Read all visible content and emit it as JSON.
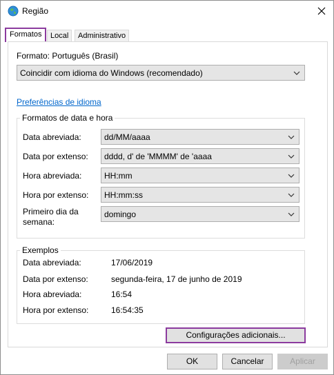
{
  "window": {
    "title": "Região"
  },
  "tabs": [
    {
      "label": "Formatos"
    },
    {
      "label": "Local"
    },
    {
      "label": "Administrativo"
    }
  ],
  "format": {
    "label": "Formato: Português (Brasil)",
    "selected": "Coincidir com idioma do Windows (recomendado)"
  },
  "language_prefs_link": "Preferências de idioma",
  "date_time_formats": {
    "title": "Formatos de data e hora",
    "rows": [
      {
        "label": "Data abreviada:",
        "value": "dd/MM/aaaa"
      },
      {
        "label": "Data por extenso:",
        "value": "dddd, d' de 'MMMM' de 'aaaa"
      },
      {
        "label": "Hora abreviada:",
        "value": "HH:mm"
      },
      {
        "label": "Hora por extenso:",
        "value": "HH:mm:ss"
      },
      {
        "label": "Primeiro dia da semana:",
        "value": "domingo"
      }
    ]
  },
  "examples": {
    "title": "Exemplos",
    "rows": [
      {
        "label": "Data abreviada:",
        "value": "17/06/2019"
      },
      {
        "label": "Data por extenso:",
        "value": "segunda-feira, 17 de junho de 2019"
      },
      {
        "label": "Hora abreviada:",
        "value": "16:54"
      },
      {
        "label": "Hora por extenso:",
        "value": "16:54:35"
      }
    ]
  },
  "buttons": {
    "additional": "Configurações adicionais...",
    "ok": "OK",
    "cancel": "Cancelar",
    "apply": "Aplicar"
  },
  "colors": {
    "highlight": "#8b3a9e",
    "link": "#0066cc"
  }
}
